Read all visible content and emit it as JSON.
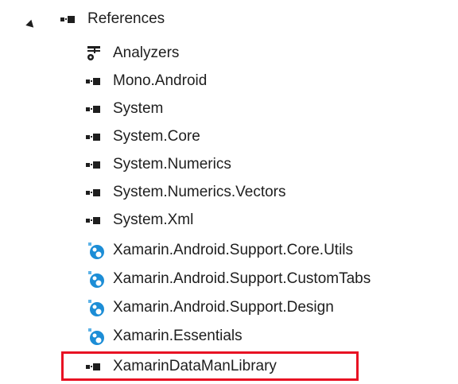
{
  "tree": {
    "root": {
      "label": "References",
      "expanded": true,
      "icon": "reference-icon"
    },
    "items": [
      {
        "label": "Analyzers",
        "icon": "analyzer-icon"
      },
      {
        "label": "Mono.Android",
        "icon": "reference-icon"
      },
      {
        "label": "System",
        "icon": "reference-icon"
      },
      {
        "label": "System.Core",
        "icon": "reference-icon"
      },
      {
        "label": "System.Numerics",
        "icon": "reference-icon"
      },
      {
        "label": "System.Numerics.Vectors",
        "icon": "reference-icon"
      },
      {
        "label": "System.Xml",
        "icon": "reference-icon"
      },
      {
        "label": "Xamarin.Android.Support.Core.Utils",
        "icon": "nuget-package-icon"
      },
      {
        "label": "Xamarin.Android.Support.CustomTabs",
        "icon": "nuget-package-icon"
      },
      {
        "label": "Xamarin.Android.Support.Design",
        "icon": "nuget-package-icon"
      },
      {
        "label": "Xamarin.Essentials",
        "icon": "nuget-package-icon"
      },
      {
        "label": "XamarinDataManLibrary",
        "icon": "reference-icon",
        "highlighted": true
      }
    ]
  },
  "colors": {
    "text": "#1e1e1e",
    "highlight_border": "#e81123",
    "package_blue": "#1c8dd6",
    "package_light_blue": "#5fb4e8"
  }
}
